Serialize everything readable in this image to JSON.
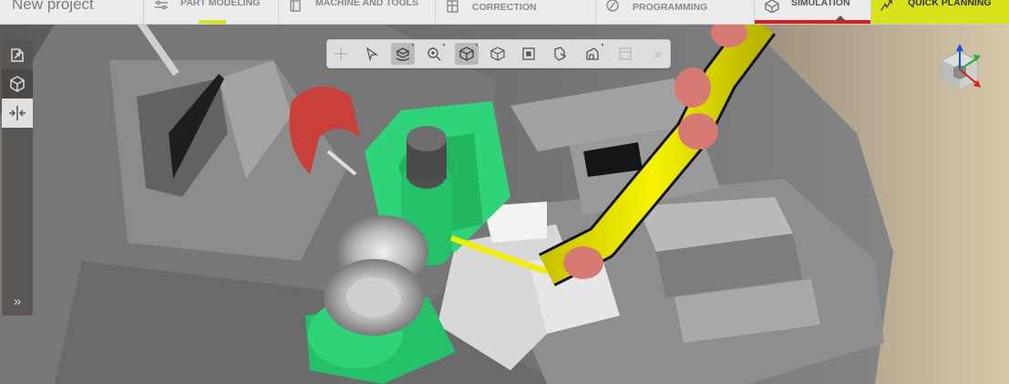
{
  "app": {
    "project_name": "New project"
  },
  "tabs": [
    {
      "label": "PART MODELING",
      "icon": "sliders-icon",
      "bar_color": "#d8e21a"
    },
    {
      "label": "MACHINE AND TOOLS",
      "icon": "machine-icon",
      "bar_color": ""
    },
    {
      "label": "CORRECTION",
      "icon": "correction-icon",
      "bar_color": ""
    },
    {
      "label": "PROGRAMMING",
      "icon": "programming-icon",
      "bar_color": ""
    },
    {
      "label": "SIMULATION",
      "icon": "simulation-icon",
      "bar_color": "#d0202a",
      "active": true
    },
    {
      "label": "QUICK PLANNING",
      "icon": "quick-planning-icon",
      "bar_color": "#d8e21a"
    }
  ],
  "left_toolbar": [
    {
      "name": "export-icon",
      "state": "normal"
    },
    {
      "name": "cube-view-icon",
      "state": "active"
    },
    {
      "name": "collapse-icon",
      "state": "light"
    }
  ],
  "left_toolbar_expand": "»",
  "view_toolbar": [
    {
      "name": "pin-icon",
      "selected": false,
      "disabled": true
    },
    {
      "name": "select-icon",
      "selected": false
    },
    {
      "name": "orbit-icon",
      "selected": true
    },
    {
      "name": "zoom-icon",
      "selected": false
    },
    {
      "name": "solid-view-icon",
      "selected": true
    },
    {
      "name": "wireframe-view-icon",
      "selected": false
    },
    {
      "name": "fit-view-icon",
      "selected": false
    },
    {
      "name": "perspective-icon",
      "selected": false
    },
    {
      "name": "measure-icon",
      "selected": false
    },
    {
      "name": "screenshot-icon",
      "selected": false,
      "disabled": true
    }
  ],
  "view_toolbar_expand": "»",
  "colors": {
    "accent_yellow": "#d8e21a",
    "active_red": "#d0202a",
    "tube_yellow": "#f2ee00",
    "tool_green": "#2fd37a",
    "clamp_red": "#c9403a"
  },
  "navigation": {
    "axes": [
      "x-axis-icon",
      "y-axis-icon",
      "z-axis-icon"
    ]
  }
}
